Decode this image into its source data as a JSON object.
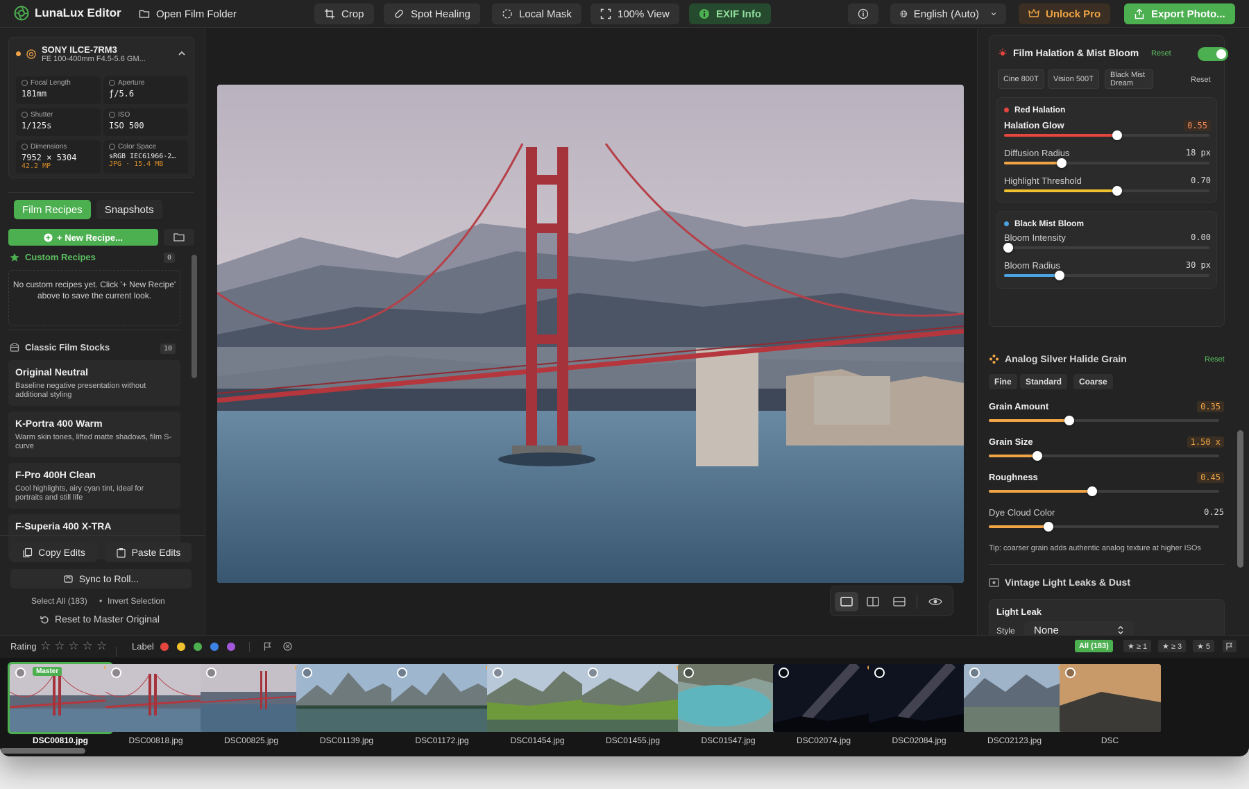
{
  "app": {
    "name": "LunaLux Editor"
  },
  "toolbar": {
    "open_folder": "Open Film Folder",
    "crop": "Crop",
    "spot_healing": "Spot Healing",
    "local_mask": "Local Mask",
    "view_100": "100% View",
    "exif_info": "EXIF Info",
    "language": "English (Auto)",
    "unlock": "Unlock Pro",
    "export": "Export Photo..."
  },
  "camera": {
    "model": "SONY ILCE-7RM3",
    "lens": "FE 100-400mm F4.5-5.6 GM...",
    "focal_label": "Focal Length",
    "focal": "181mm",
    "aperture_label": "Aperture",
    "aperture": "ƒ/5.6",
    "shutter_label": "Shutter",
    "shutter": "1/125s",
    "iso_label": "ISO",
    "iso": "ISO 500",
    "dim_label": "Dimensions",
    "dimensions": "7952 × 5304",
    "megapixels": "42.2 MP",
    "cs_label": "Color Space",
    "color_space": "sRGB IEC61966-2…",
    "file_info": "JPG · 15.4 MB"
  },
  "left": {
    "tab_recipes": "Film Recipes",
    "tab_snapshots": "Snapshots",
    "new_recipe": "+ New Recipe...",
    "custom_title": "Custom Recipes",
    "custom_count": "0",
    "empty_text": "No custom recipes yet. Click '+ New Recipe' above to save the current look.",
    "classic_title": "Classic Film Stocks",
    "classic_count": "10",
    "stocks": [
      {
        "name": "Original Neutral",
        "desc": "Baseline negative presentation without additional styling"
      },
      {
        "name": "K-Portra 400 Warm",
        "desc": "Warm skin tones, lifted matte shadows, film S-curve"
      },
      {
        "name": "F-Pro 400H Clean",
        "desc": "Cool highlights, airy cyan tint, ideal for portraits and still life"
      },
      {
        "name": "F-Superia 400 X-TRA",
        "desc": ""
      }
    ],
    "copy_edits": "Copy Edits",
    "paste_edits": "Paste Edits",
    "sync_roll": "Sync to Roll...",
    "select_all": "Select All (183)",
    "bullet": "•",
    "invert": "Invert Selection",
    "reset_master": "Reset to Master Original"
  },
  "halation": {
    "title": "Film Halation & Mist Bloom",
    "reset": "Reset",
    "enabled": true,
    "presets": [
      "Cine 800T",
      "Vision 500T",
      "Black Mist Dream"
    ],
    "presets_reset": "Reset",
    "red_title": "Red Halation",
    "glow_label": "Halation Glow",
    "glow_value": "0.55",
    "glow_level": 0.55,
    "diffusion_label": "Diffusion Radius",
    "diffusion_value": "18 px",
    "diffusion_level": 0.28,
    "threshold_label": "Highlight Threshold",
    "threshold_value": "0.70",
    "threshold_level": 0.55,
    "mist_title": "Black Mist Bloom",
    "bloom_int_label": "Bloom Intensity",
    "bloom_int_value": "0.00",
    "bloom_int_level": 0.02,
    "bloom_rad_label": "Bloom Radius",
    "bloom_rad_value": "30 px",
    "bloom_rad_level": 0.27
  },
  "grain": {
    "title": "Analog Silver Halide Grain",
    "reset": "Reset",
    "types": [
      "Fine",
      "Standard",
      "Coarse"
    ],
    "amount_label": "Grain Amount",
    "amount_value": "0.35",
    "amount_level": 0.35,
    "size_label": "Grain Size",
    "size_value": "1.50 x",
    "size_level": 0.21,
    "rough_label": "Roughness",
    "rough_value": "0.45",
    "rough_level": 0.45,
    "dye_label": "Dye Cloud Color",
    "dye_value": "0.25",
    "dye_level": 0.26,
    "tip": "Tip: coarser grain adds authentic analog texture at higher ISOs"
  },
  "leaks": {
    "title": "Vintage Light Leaks & Dust",
    "light_leak": "Light Leak",
    "style_label": "Style",
    "style_value": "None"
  },
  "filterbar": {
    "rating": "Rating",
    "label": "Label",
    "label_colors": [
      "#e5463d",
      "#f2c12e",
      "#4caf50",
      "#3d82e5",
      "#a157d8"
    ],
    "all": "All (183)",
    "r1": "★ ≥ 1",
    "r3": "★ ≥ 3",
    "r5": "★ 5"
  },
  "filmstrip": [
    {
      "name": "DSC00810.jpg",
      "selected": true,
      "master": "Master",
      "scene": "bridge"
    },
    {
      "name": "DSC00818.jpg",
      "scene": "bridge"
    },
    {
      "name": "DSC00825.jpg",
      "scene": "bridge2"
    },
    {
      "name": "DSC01139.jpg",
      "scene": "lake"
    },
    {
      "name": "DSC01172.jpg",
      "scene": "lake"
    },
    {
      "name": "DSC01454.jpg",
      "scene": "valley"
    },
    {
      "name": "DSC01455.jpg",
      "scene": "valley"
    },
    {
      "name": "DSC01547.jpg",
      "scene": "turquoise"
    },
    {
      "name": "DSC02074.jpg",
      "scene": "night"
    },
    {
      "name": "DSC02084.jpg",
      "scene": "night"
    },
    {
      "name": "DSC02123.jpg",
      "scene": "mountain"
    },
    {
      "name": "DSC",
      "scene": "sunset"
    }
  ]
}
